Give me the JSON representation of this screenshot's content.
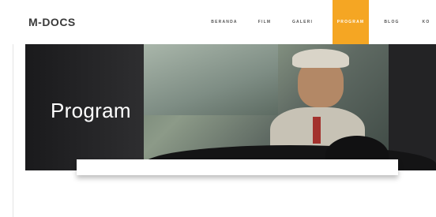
{
  "header": {
    "logo": "M-DOCS",
    "nav": [
      {
        "label": "BERANDA",
        "active": false
      },
      {
        "label": "FILM",
        "active": false
      },
      {
        "label": "GALERI",
        "active": false
      },
      {
        "label": "PROGRAM",
        "active": true
      },
      {
        "label": "BLOG",
        "active": false
      },
      {
        "label": "KO",
        "active": false
      }
    ]
  },
  "hero": {
    "title": "Program"
  },
  "colors": {
    "accent": "#f5a623",
    "text": "#3a3a3a"
  }
}
